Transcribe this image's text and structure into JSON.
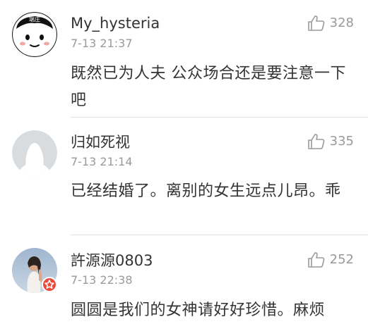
{
  "comments": [
    {
      "username": "My_hysteria",
      "timestamp": "7-13 21:37",
      "likes": "328",
      "text": "既然已为人夫 公众场合还是要注意一下吧",
      "avatar_badge_text": "端庄",
      "avatar_icon": "cartoon-face-avatar"
    },
    {
      "username": "归如死视",
      "timestamp": "7-13 21:14",
      "likes": "335",
      "text": "已经结婚了。离别的女生远点儿昂。乖",
      "avatar_icon": "default-silhouette-avatar"
    },
    {
      "username": "許源源0803",
      "timestamp": "7-13 22:38",
      "likes": "252",
      "text": "圆圆是我们的女神请好好珍惜。麻烦",
      "avatar_icon": "photo-avatar",
      "badge_icon": "star-badge-icon"
    }
  ],
  "like_icon": "thumbs-up-icon",
  "colors": {
    "text_primary": "#333333",
    "text_secondary": "#9a9a9a",
    "divider": "#e3e3e3",
    "badge_red": "#e84c3d"
  }
}
